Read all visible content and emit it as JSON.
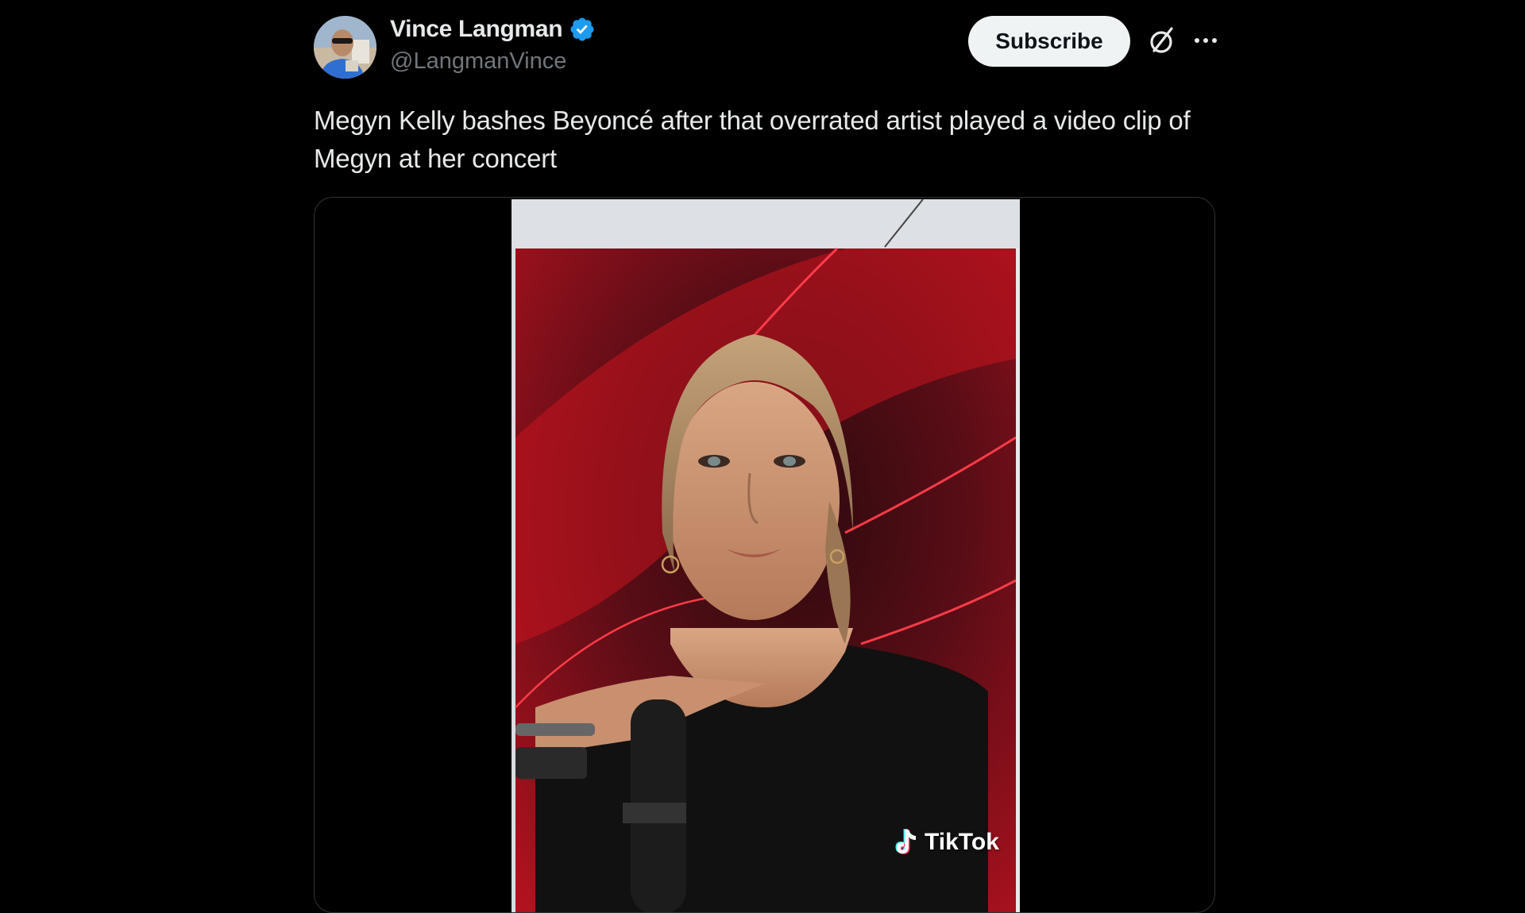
{
  "author": {
    "display_name": "Vince Langman",
    "handle": "@LangmanVince",
    "verified_icon": "verified-badge-icon",
    "verified_color": "#1d9bf0"
  },
  "header": {
    "subscribe_label": "Subscribe",
    "grok_icon": "grok-icon",
    "more_icon": "more-dots-icon"
  },
  "tweet": {
    "text": "Megyn Kelly bashes Beyoncé after that overrated artist played a video clip of Megyn at her concert"
  },
  "media": {
    "type": "video",
    "watermark_label": "TikTok",
    "watermark_icon": "tiktok-logo-icon"
  },
  "colors": {
    "background": "#000000",
    "text_primary": "#e7e9ea",
    "text_secondary": "#71767b",
    "subscribe_bg": "#eff3f4",
    "border": "#2f3336"
  }
}
